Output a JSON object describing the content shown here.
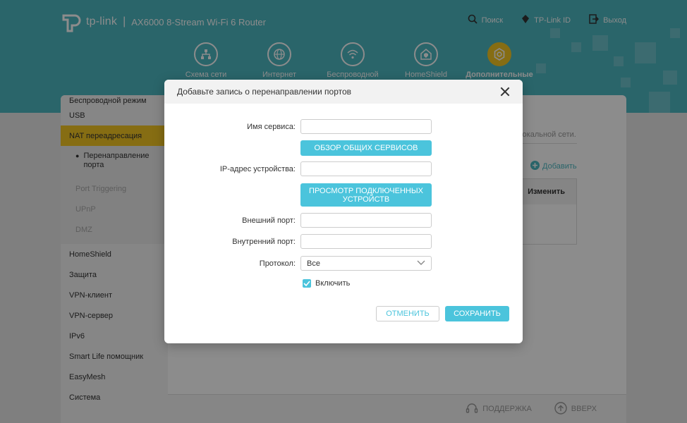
{
  "header": {
    "brand": "tp-link",
    "separator": "|",
    "model": "AX6000 8-Stream Wi-Fi 6 Router",
    "actions": [
      {
        "label": "Поиск",
        "icon": "search-icon"
      },
      {
        "label": "TP-Link ID",
        "icon": "tplink-id-icon"
      },
      {
        "label": "Выход",
        "icon": "logout-icon"
      }
    ],
    "nav": [
      {
        "label": "Схема сети",
        "icon": "network-map-icon"
      },
      {
        "label": "Интернет",
        "icon": "globe-icon"
      },
      {
        "label": "Беспроводной",
        "icon": "wifi-icon"
      },
      {
        "label": "HomeShield",
        "icon": "homeshield-icon"
      },
      {
        "label": "Дополнительные",
        "icon": "gear-icon",
        "active": true
      }
    ]
  },
  "sidebar": {
    "items_top": [
      "Беспроводной режим",
      "USB",
      "NAT переадресация"
    ],
    "sub_items": [
      "Перенаправление порта",
      "Port Triggering",
      "UPnP",
      "DMZ"
    ],
    "items_bottom": [
      "HomeShield",
      "Защита",
      "VPN-клиент",
      "VPN-сервер",
      "IPv6",
      "Smart Life помощник",
      "EasyMesh",
      "Система"
    ]
  },
  "main": {
    "hint": "локальной сети.",
    "add_label": "Добавить",
    "table_header_modify": "Изменить"
  },
  "footer": {
    "support": "ПОДДЕРЖКА",
    "up": "ВВЕРХ"
  },
  "modal": {
    "title": "Добавьте запись о перенаправлении портов",
    "service_name_label": "Имя сервиса:",
    "service_name_value": "",
    "browse_services": "ОБЗОР ОБЩИХ СЕРВИСОВ",
    "device_ip_label": "IP-адрес устройства:",
    "device_ip_value": "",
    "view_devices": "ПРОСМОТР ПОДКЛЮЧЕННЫХ УСТРОЙСТВ",
    "external_port_label": "Внешний порт:",
    "external_port_value": "",
    "internal_port_label": "Внутренний порт:",
    "internal_port_value": "",
    "protocol_label": "Протокол:",
    "protocol_value": "Все",
    "enable_label": "Включить",
    "enable_checked": true,
    "cancel": "ОТМЕНИТЬ",
    "save": "СОХРАНИТЬ"
  },
  "colors": {
    "header": "#4db8c2",
    "accent": "#4bc4dc",
    "active_nav": "#f4c623"
  }
}
